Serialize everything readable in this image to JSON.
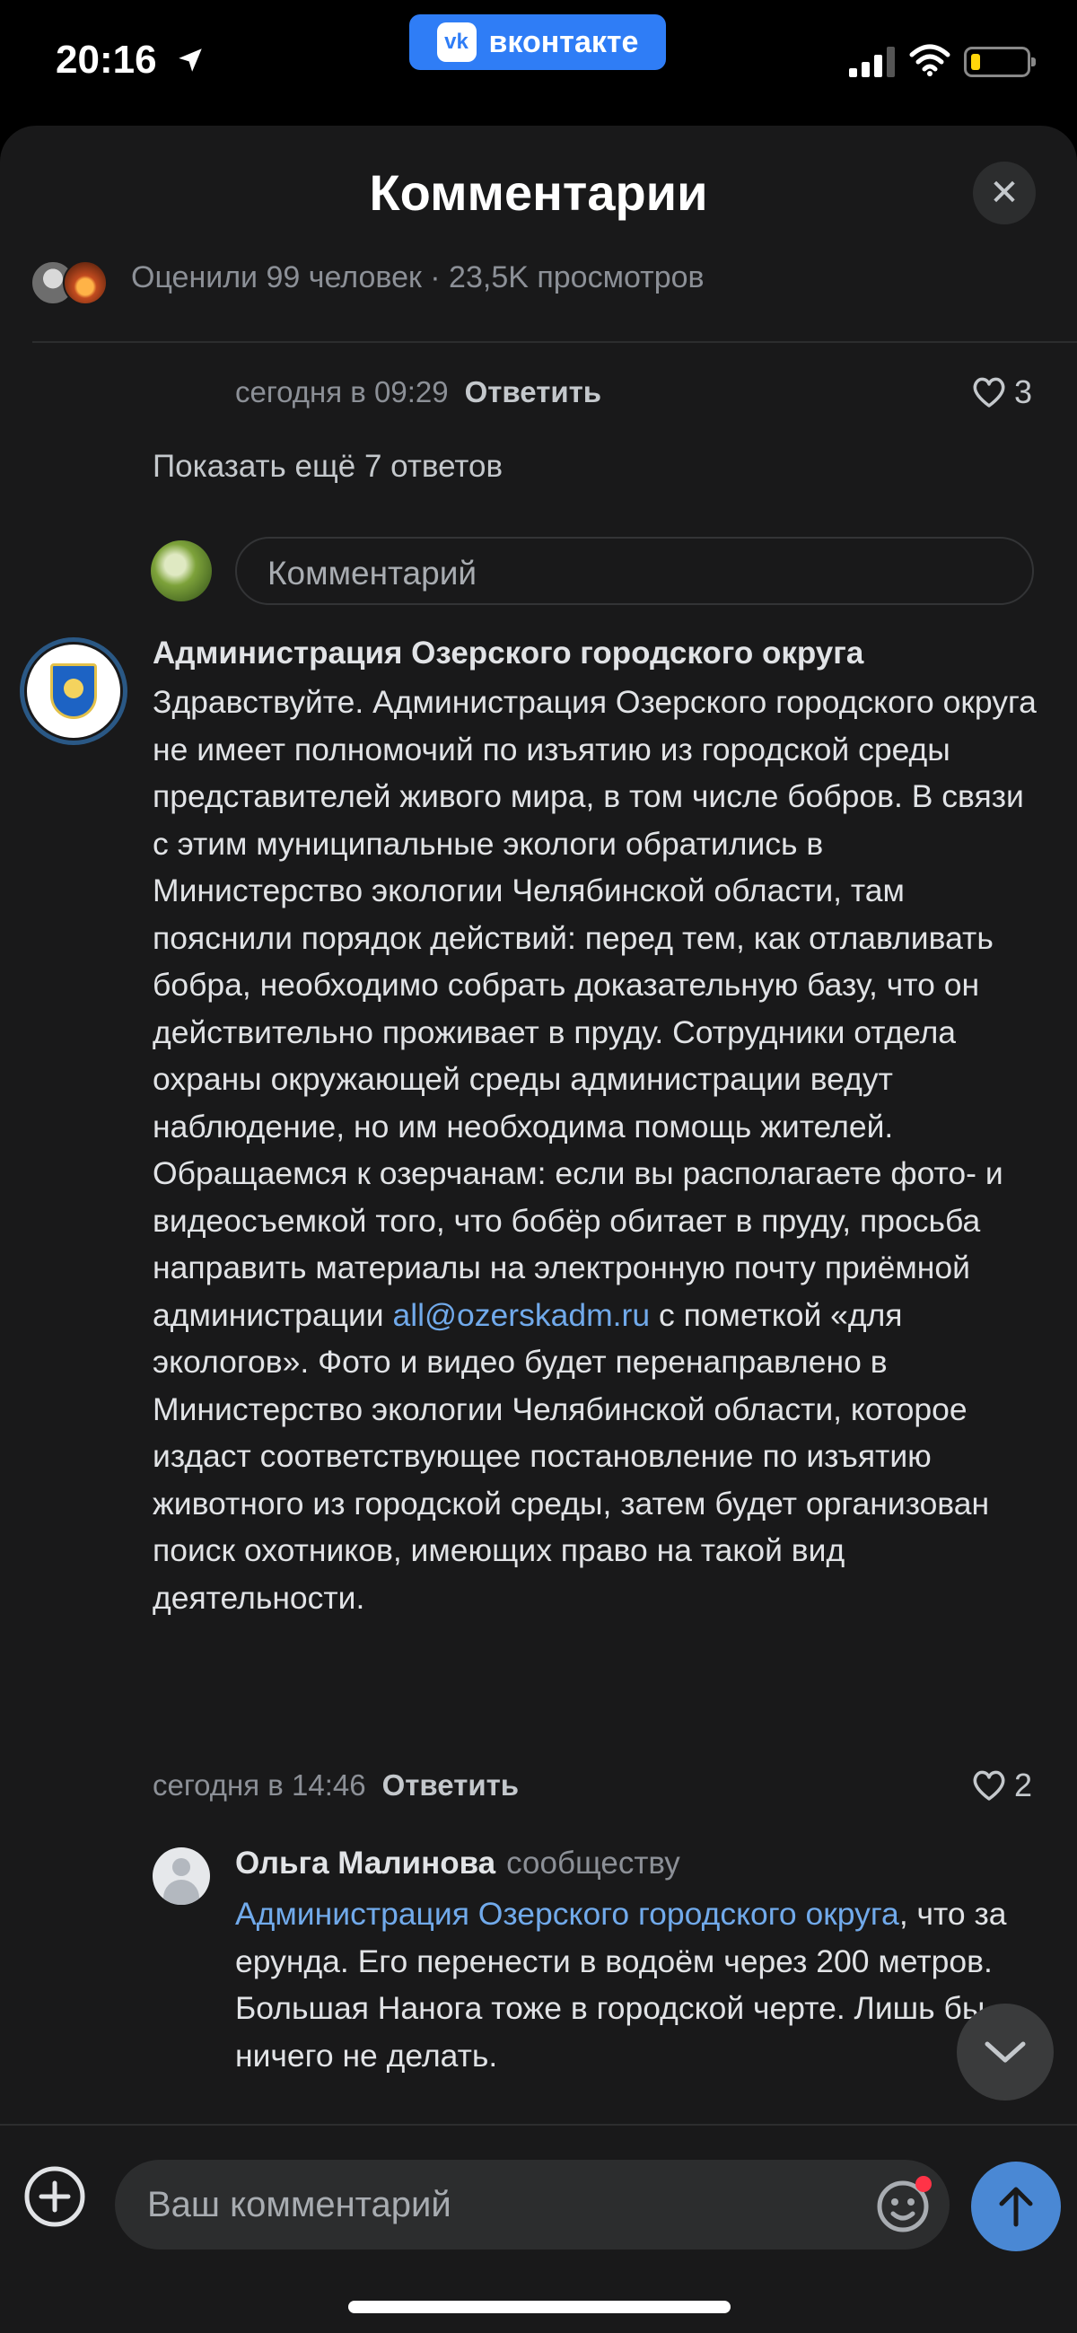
{
  "status_bar": {
    "time": "20:16",
    "app_pill": "вконтакте",
    "vk_logo": "vk"
  },
  "sheet": {
    "title": "Комментарии",
    "close_glyph": "✕",
    "stats": "Оценили 99 человек · 23,5K просмотров"
  },
  "prev_comment": {
    "time": "сегодня в 09:29",
    "reply_label": "Ответить",
    "likes": "3"
  },
  "show_more": "Показать ещё 7 ответов",
  "comment_input": {
    "placeholder": "Комментарий"
  },
  "admin_comment": {
    "author": "Администрация Озерского городского округа",
    "text_part1": "Здравствуйте. Администрация Озерского городского округа не имеет полномочий по изъятию из городской среды представителей живого мира, в том числе бобров. В связи с этим муниципальные экологи обратились в Министерство экологии Челябинской области, там пояснили порядок действий: перед тем, как отлавливать бобра, необходимо собрать доказательную базу, что он действительно проживает в пруду. Сотрудники отдела охраны окружающей среды администрации ведут наблюдение, но им необходима помощь жителей. Обращаемся к озерчанам: если вы располагаете фото- и видеосъемкой того, что бобёр обитает в пруду, просьба направить материалы на электронную почту приёмной администрации ",
    "email": "all@ozerskadm.ru",
    "text_part2": " с пометкой «для экологов». Фото и видео будет перенаправлено в Министерство экологии Челябинской области, которое издаст соответствующее постановление по изъятию животного из городской среды, затем будет организован поиск охотников, имеющих право на такой вид деятельности.",
    "time": "сегодня в 14:46",
    "reply_label": "Ответить",
    "likes": "2"
  },
  "reply_comment": {
    "author": "Ольга Малинова",
    "target": "сообществу",
    "mention": "Администрация Озерского городского округа",
    "text": ", что за ерунда. Его перенести в водоём через 200 метров. Большая Нанога тоже в городской черте. Лишь бы ничего не делать."
  },
  "composer": {
    "placeholder": "Ваш комментарий"
  },
  "colors": {
    "background": "#19191a",
    "link": "#71aaeb",
    "vk_blue": "#2f7df6",
    "send_button": "#4a88d4"
  },
  "icons": [
    "location-arrow-icon",
    "signal-icon",
    "wifi-icon",
    "battery-icon",
    "close-icon",
    "heart-icon",
    "chevron-down-icon",
    "plus-icon",
    "emoji-icon",
    "send-arrow-icon"
  ]
}
